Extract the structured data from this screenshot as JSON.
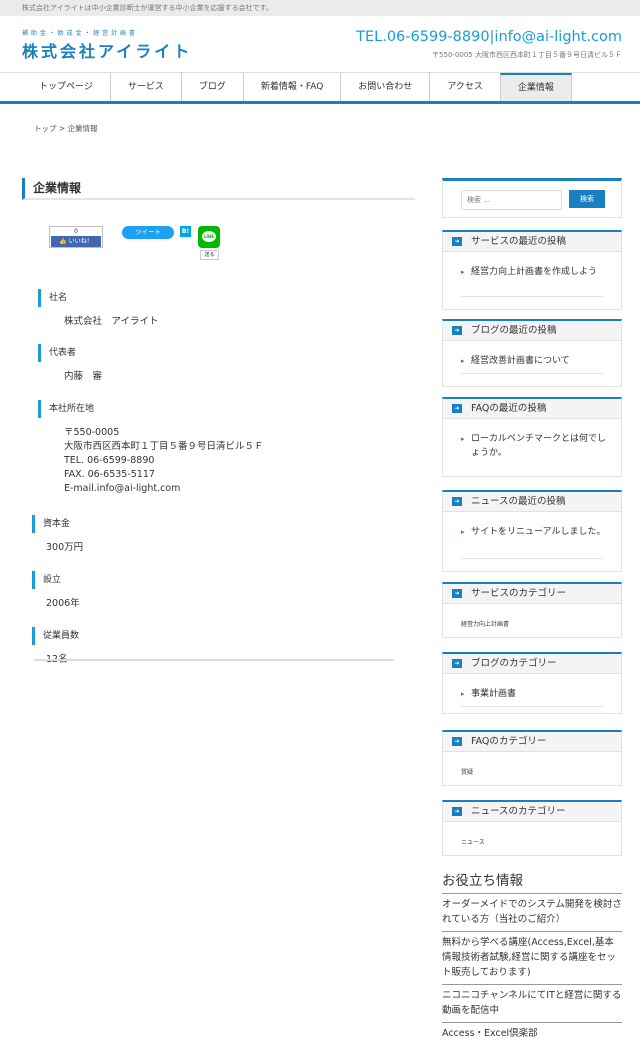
{
  "topbar": {
    "text": "株式会社アイライトは中小企業診断士が運営する中小企業を応援する会社です。"
  },
  "header": {
    "logo_tag": "補 助 金 ・ 助 成 金 ・ 経 営 計 画 書",
    "logo_name": "株式会社アイライト",
    "tel": "TEL.06-6599-8890|info@ai-light.com",
    "address": "〒550-0005 大阪市西区西本町１丁目５番９号日清ビル５Ｆ"
  },
  "nav": {
    "items": [
      {
        "label": "トップページ"
      },
      {
        "label": "サービス"
      },
      {
        "label": "ブログ"
      },
      {
        "label": "新着情報・FAQ"
      },
      {
        "label": "お問い合わせ"
      },
      {
        "label": "アクセス"
      },
      {
        "label": "企業情報"
      }
    ]
  },
  "breadcrumb": {
    "text": "トップ > 企業情報"
  },
  "main": {
    "title": "企業情報",
    "share": {
      "fb_count": "0",
      "fb_like": "👍 いいね！",
      "tweet": "ツイート",
      "hatena": "B!",
      "line": "LINE",
      "line_send": "送る"
    },
    "info": [
      {
        "label": "社名",
        "value": [
          "株式会社　アイライト"
        ]
      },
      {
        "label": "代表者",
        "value": [
          "内藤　審"
        ]
      },
      {
        "label": "本社所在地",
        "value": [
          "〒550-0005",
          "大阪市西区西本町１丁目５番９号日清ビル５Ｆ",
          "TEL. 06-6599-8890",
          "FAX. 06-6535-5117",
          "E-mail.info@ai-light.com"
        ]
      },
      {
        "label": "資本金",
        "value": [
          "300万円"
        ]
      },
      {
        "label": "設立",
        "value": [
          "2006年"
        ]
      },
      {
        "label": "従業員数",
        "value": [
          "12名"
        ]
      }
    ]
  },
  "sidebar": {
    "search_placeholder": "検索 …",
    "search_button": "検索",
    "widgets": [
      {
        "title": "サービスの最近の投稿",
        "items": [
          "経営力向上計画書を作成しよう"
        ]
      },
      {
        "title": "ブログの最近の投稿",
        "items": [
          "経営改善計画書について"
        ]
      },
      {
        "title": "FAQの最近の投稿",
        "items": [
          "ローカルベンチマークとは何でしょうか。"
        ]
      },
      {
        "title": "ニュースの最近の投稿",
        "items": [
          "サイトをリニューアルしました。"
        ]
      },
      {
        "title": "サービスのカテゴリー",
        "small": "経営力向上計画書"
      },
      {
        "title": "ブログのカテゴリー",
        "items": [
          "事業計画書"
        ]
      },
      {
        "title": "FAQのカテゴリー",
        "small": "質疑"
      },
      {
        "title": "ニュースのカテゴリー",
        "small": "ニュース"
      }
    ],
    "useful": {
      "title": "お役立ち情報",
      "items": [
        "オーダーメイドでのシステム開発を検討されている方（当社のご紹介）",
        "無料から学べる講座(Access,Excel,基本情報技術者試験,経営に関する講座をセット販売しております)",
        "ニコニコチャンネルにてITと経営に関する動画を配信中",
        "Access・Excel倶楽部"
      ]
    }
  },
  "colors": {
    "accent": "#1a7fc1",
    "tel": "#1a9cd8"
  }
}
